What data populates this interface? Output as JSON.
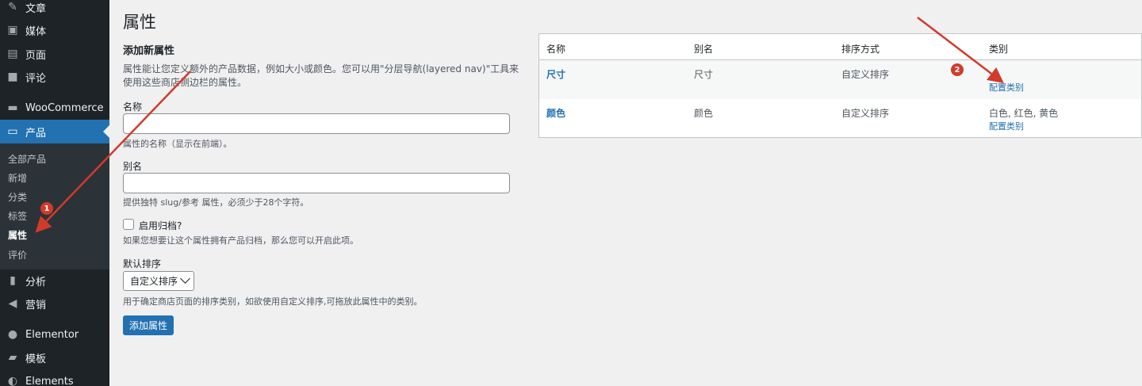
{
  "sidebar": {
    "items": [
      {
        "label": "文章",
        "icon": "pin-icon"
      },
      {
        "label": "媒体",
        "icon": "media-icon"
      },
      {
        "label": "页面",
        "icon": "page-icon"
      },
      {
        "label": "评论",
        "icon": "comment-icon"
      },
      {
        "label": "WooCommerce",
        "icon": "woo-icon"
      },
      {
        "label": "产品",
        "icon": "archive-icon"
      },
      {
        "label": "分析",
        "icon": "chart-icon"
      },
      {
        "label": "营销",
        "icon": "megaphone-icon"
      },
      {
        "label": "Elementor",
        "icon": "elementor-icon"
      },
      {
        "label": "模板",
        "icon": "folder-icon"
      },
      {
        "label": "Elements",
        "icon": "elements-icon"
      }
    ],
    "submenu": [
      "全部产品",
      "新增",
      "分类",
      "标签",
      "属性",
      "评价"
    ],
    "active_color": "#2271b1"
  },
  "page": {
    "title": "属性"
  },
  "form": {
    "heading": "添加新属性",
    "description": "属性能让您定义额外的产品数据，例如大小或颜色。您可以用\"分层导航(layered nav)\"工具来使用这些商店侧边栏的属性。",
    "name_label": "名称",
    "name_value": "",
    "name_help": "属性的名称（显示在前端）。",
    "slug_label": "别名",
    "slug_value": "",
    "slug_help": "提供独特 slug/参考 属性，必须少于28个字符。",
    "archive_label": "启用归档?",
    "archive_help": "如果您想要让这个属性拥有产品归档，那么您可以开启此项。",
    "order_label": "默认排序",
    "order_value": "自定义排序",
    "order_help": "用于确定商店页面的排序类别，如欲使用自定义排序,可拖放此属性中的类别。",
    "submit_label": "添加属性"
  },
  "table": {
    "headers": [
      "名称",
      "别名",
      "排序方式",
      "类别"
    ],
    "rows": [
      {
        "name": "尺寸",
        "slug": "尺寸",
        "order": "自定义排序",
        "terms": "–",
        "configure": "配置类别"
      },
      {
        "name": "颜色",
        "slug": "颜色",
        "order": "自定义排序",
        "terms": "白色, 红色, 黄色",
        "configure": "配置类别"
      }
    ]
  },
  "annotations": {
    "badge1": "1",
    "badge2": "2",
    "arrow_color": "#d13b2a"
  }
}
